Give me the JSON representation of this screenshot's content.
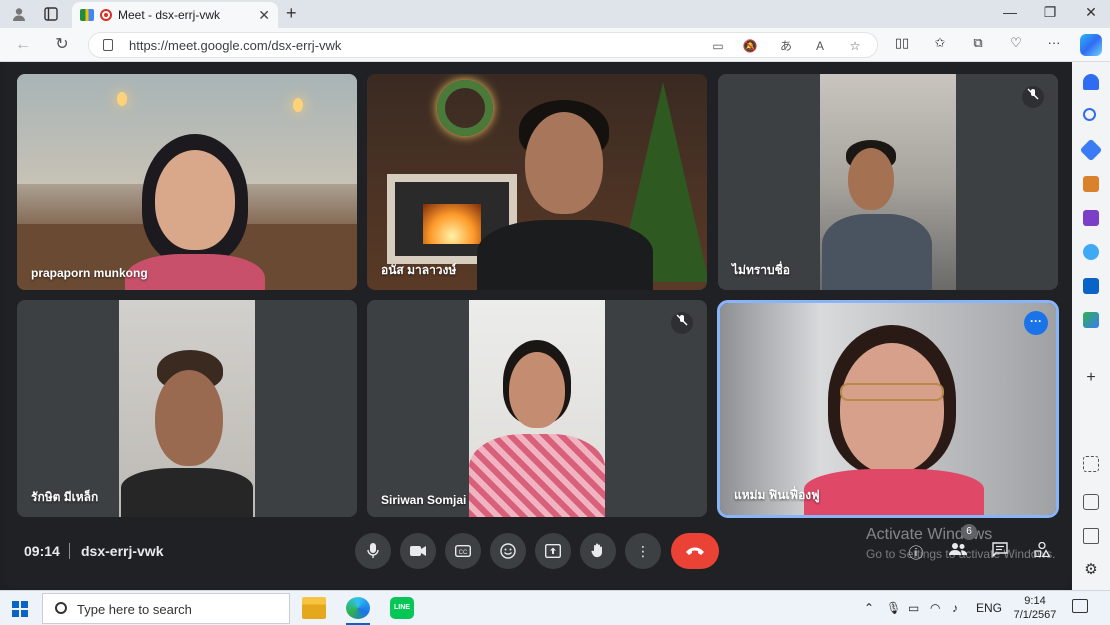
{
  "browser": {
    "tab_title": "Meet - dsx-errj-vwk",
    "tab_close": "✕",
    "new_tab": "+",
    "url": "https://meet.google.com/dsx-errj-vwk",
    "window_controls": [
      "—",
      "❐",
      "✕"
    ]
  },
  "meeting": {
    "time": "09:14",
    "code": "dsx-errj-vwk",
    "participant_count": "6",
    "participants": [
      {
        "name": "prapaporn munkong",
        "muted": false
      },
      {
        "name": "อนัส มาลาวงษ์",
        "muted": false
      },
      {
        "name": "ไม่ทราบชื่อ",
        "muted": true
      },
      {
        "name": "รักษิต มีเหล็ก",
        "muted": false
      },
      {
        "name": "Siriwan Somjai",
        "muted": true
      },
      {
        "name": "แหม่ม ฟินเฟื่องฟู",
        "muted": false,
        "active_speaker": true
      }
    ],
    "controls": [
      "microphone",
      "camera",
      "captions",
      "reactions",
      "present",
      "raise-hand",
      "more-options",
      "leave-call"
    ],
    "right_controls": [
      "meeting-info",
      "people",
      "chat",
      "activities"
    ]
  },
  "watermark": {
    "line1": "Activate Windows",
    "line2": "Go to Settings to activate Windows."
  },
  "taskbar": {
    "search_placeholder": "Type here to search",
    "language": "ENG",
    "clock_time": "9:14",
    "clock_date": "7/1/2567"
  },
  "colors": {
    "stage_bg": "#202124",
    "tile_bg": "#3c4043",
    "hangup": "#ea4335",
    "active_outline": "#8ab4f8",
    "accent_blue": "#1a73e8"
  }
}
